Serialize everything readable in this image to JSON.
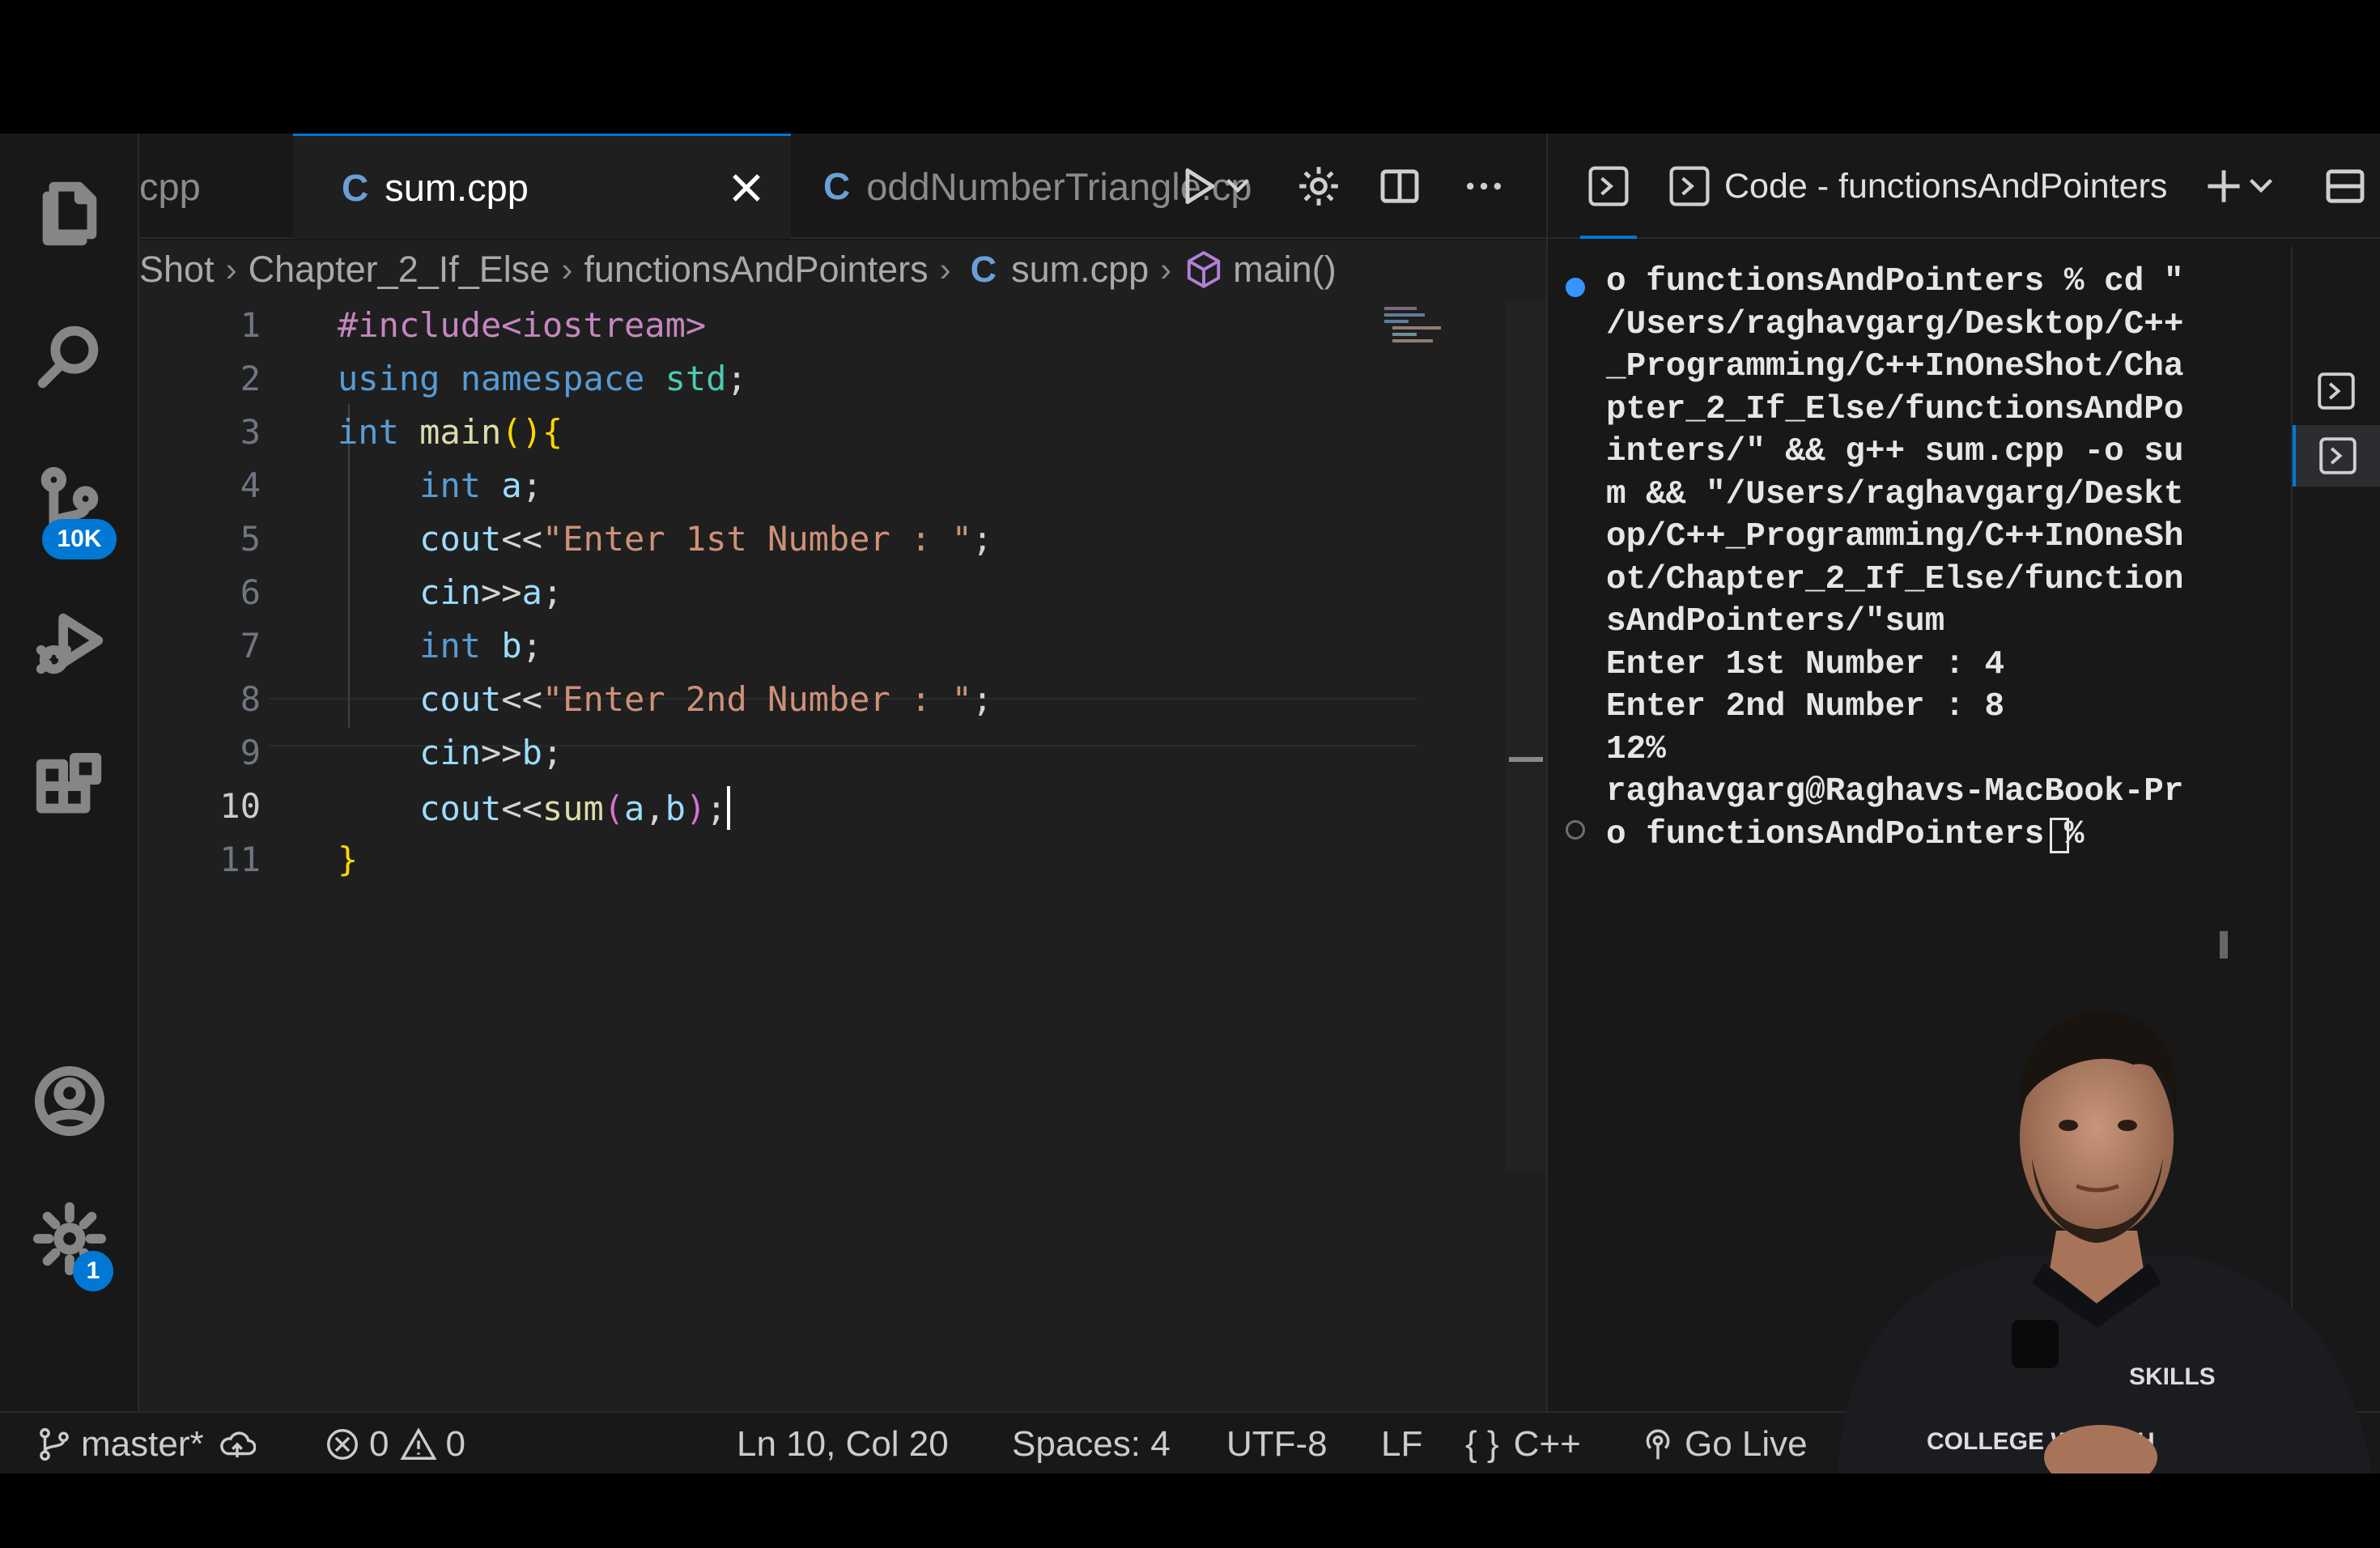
{
  "tabs": [
    {
      "label": "cpp",
      "active": false
    },
    {
      "label": "sum.cpp",
      "active": true
    },
    {
      "label": "oddNumberTriangle.cp",
      "active": false
    }
  ],
  "tab_icon_glyph": "C",
  "breadcrumb": {
    "items": [
      "Shot",
      "Chapter_2_If_Else",
      "functionsAndPointers",
      "sum.cpp",
      "main()"
    ]
  },
  "activity_bar": {
    "items": [
      "explorer-icon",
      "search-icon",
      "source-control-icon",
      "run-debug-icon",
      "extensions-icon",
      "accounts-icon",
      "manage-gear-icon"
    ],
    "source_control_badge": "10K",
    "settings_badge": "1"
  },
  "editor": {
    "line_numbers": [
      "1",
      "2",
      "3",
      "4",
      "5",
      "6",
      "7",
      "8",
      "9",
      "10",
      "11"
    ],
    "current_line": "10",
    "lines": [
      [
        {
          "t": "#include<iostream>",
          "c": "pp"
        }
      ],
      [
        {
          "t": "using",
          "c": "kw"
        },
        {
          "t": " ",
          "c": ""
        },
        {
          "t": "namespace",
          "c": "kw"
        },
        {
          "t": " ",
          "c": ""
        },
        {
          "t": "std",
          "c": "ty"
        },
        {
          "t": ";",
          "c": ""
        }
      ],
      [
        {
          "t": "int",
          "c": "kw"
        },
        {
          "t": " ",
          "c": ""
        },
        {
          "t": "main",
          "c": "fn"
        },
        {
          "t": "(){",
          "c": "br"
        }
      ],
      [
        {
          "t": "    ",
          "c": ""
        },
        {
          "t": "int",
          "c": "kw"
        },
        {
          "t": " ",
          "c": ""
        },
        {
          "t": "a",
          "c": "id"
        },
        {
          "t": ";",
          "c": ""
        }
      ],
      [
        {
          "t": "    ",
          "c": ""
        },
        {
          "t": "cout",
          "c": "id"
        },
        {
          "t": "<<",
          "c": ""
        },
        {
          "t": "\"Enter 1st Number : \"",
          "c": "st"
        },
        {
          "t": ";",
          "c": ""
        }
      ],
      [
        {
          "t": "    ",
          "c": ""
        },
        {
          "t": "cin",
          "c": "id"
        },
        {
          "t": ">>",
          "c": ""
        },
        {
          "t": "a",
          "c": "id"
        },
        {
          "t": ";",
          "c": ""
        }
      ],
      [
        {
          "t": "    ",
          "c": ""
        },
        {
          "t": "int",
          "c": "kw"
        },
        {
          "t": " ",
          "c": ""
        },
        {
          "t": "b",
          "c": "id"
        },
        {
          "t": ";",
          "c": ""
        }
      ],
      [
        {
          "t": "    ",
          "c": ""
        },
        {
          "t": "cout",
          "c": "id"
        },
        {
          "t": "<<",
          "c": ""
        },
        {
          "t": "\"Enter 2nd Number : \"",
          "c": "st"
        },
        {
          "t": ";",
          "c": ""
        }
      ],
      [
        {
          "t": "    ",
          "c": ""
        },
        {
          "t": "cin",
          "c": "id"
        },
        {
          "t": ">>",
          "c": ""
        },
        {
          "t": "b",
          "c": "id"
        },
        {
          "t": ";",
          "c": ""
        }
      ],
      [
        {
          "t": "    ",
          "c": ""
        },
        {
          "t": "cout",
          "c": "id"
        },
        {
          "t": "<<",
          "c": ""
        },
        {
          "t": "sum",
          "c": "fn"
        },
        {
          "t": "(",
          "c": "br2"
        },
        {
          "t": "a",
          "c": "id"
        },
        {
          "t": ",",
          "c": ""
        },
        {
          "t": "b",
          "c": "id"
        },
        {
          "t": ")",
          "c": "br2"
        },
        {
          "t": ";",
          "c": ""
        }
      ],
      [
        {
          "t": "}",
          "c": "br"
        }
      ]
    ]
  },
  "terminal": {
    "title": "Code - functionsAndPointers",
    "lines": [
      "o functionsAndPointers % cd \"",
      "/Users/raghavgarg/Desktop/C++",
      "_Programming/C++InOneShot/Cha",
      "pter_2_If_Else/functionsAndPo",
      "inters/\" && g++ sum.cpp -o su",
      "m && \"/Users/raghavgarg/Deskt",
      "op/C++_Programming/C++InOneSh",
      "ot/Chapter_2_If_Else/function",
      "sAndPointers/\"sum",
      "Enter 1st Number : 4",
      "Enter 2nd Number : 8",
      "12%",
      "raghavgarg@Raghavs-MacBook-Pr",
      "o functionsAndPointers % "
    ]
  },
  "status_bar": {
    "branch": "master*",
    "errors": "0",
    "warnings": "0",
    "position": "Ln 10, Col 20",
    "spaces": "Spaces: 4",
    "encoding": "UTF-8",
    "eol": "LF",
    "language": "C++",
    "go_live": "Go Live"
  },
  "overlay": {
    "shirt_text_1": "SKILLS",
    "shirt_text_2": "COLLEGE WALLAH"
  },
  "colors": {
    "accent": "#0078d4",
    "keyword": "#569cd6",
    "string": "#ce9178",
    "function": "#dcdcaa",
    "identifier": "#9cdcfe"
  }
}
